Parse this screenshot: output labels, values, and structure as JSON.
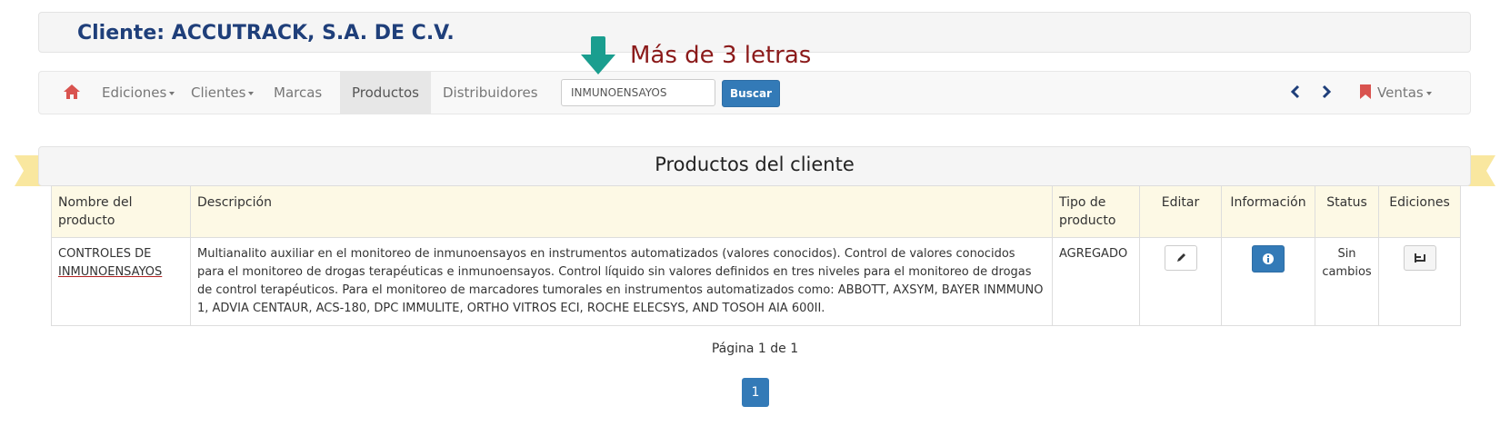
{
  "client": {
    "title": "Cliente: ACCUTRACK, S.A. DE C.V."
  },
  "nav": {
    "home_icon": "home-icon",
    "items": [
      {
        "label": "Ediciones",
        "dropdown": true
      },
      {
        "label": "Clientes",
        "dropdown": true
      },
      {
        "label": "Marcas",
        "dropdown": false
      },
      {
        "label": "Productos",
        "dropdown": false,
        "active": true
      },
      {
        "label": "Distribuidores",
        "dropdown": false
      }
    ],
    "search_value": "INMUNOENSAYOS",
    "search_button": "Buscar",
    "prev_icon": "chevron-left-icon",
    "next_icon": "chevron-right-icon",
    "bookmark_icon": "bookmark-icon",
    "sales_label": "Ventas"
  },
  "hint": {
    "text": "Más de 3 letras",
    "arrow_color": "#1a9e8f",
    "icon": "arrow-down-icon"
  },
  "panel": {
    "title": "Productos del cliente"
  },
  "table": {
    "headers": [
      "Nombre del producto",
      "Descripción",
      "Tipo de producto",
      "Editar",
      "Información",
      "Status",
      "Ediciones"
    ],
    "rows": [
      {
        "name_line1": "CONTROLES DE",
        "name_line2": "INMUNOENSAYOS",
        "description": "Multianalito auxiliar en el monitoreo de inmunoensayos en instrumentos automatizados (valores conocidos). Control de valores conocidos para el monitoreo de drogas terapéuticas e inmunoensayos. Control líquido sin valores definidos en tres niveles para el monitoreo de drogas de control terapéuticos. Para el monitoreo de marcadores tumorales en instrumentos automatizados como: ABBOTT, AXSYM, BAYER INMMUNO 1, ADVIA CENTAUR, ACS-180, DPC IMMULITE, ORTHO VITROS ECI, ROCHE ELECSYS, AND TOSOH AIA 600II.",
        "type": "AGREGADO",
        "edit_icon": "pencil-icon",
        "info_icon": "info-icon",
        "status": "Sin cambios",
        "editions_icon": "editions-icon"
      }
    ]
  },
  "pagination": {
    "label": "Página 1 de 1",
    "current": "1"
  },
  "colors": {
    "accent": "#337ab7",
    "home": "#d9534f",
    "bookmark": "#d9534f",
    "header_bg": "#fdf9e5",
    "ribbon": "#f9e79f",
    "title": "#1f3f7a",
    "hint": "#8b1a1a"
  }
}
